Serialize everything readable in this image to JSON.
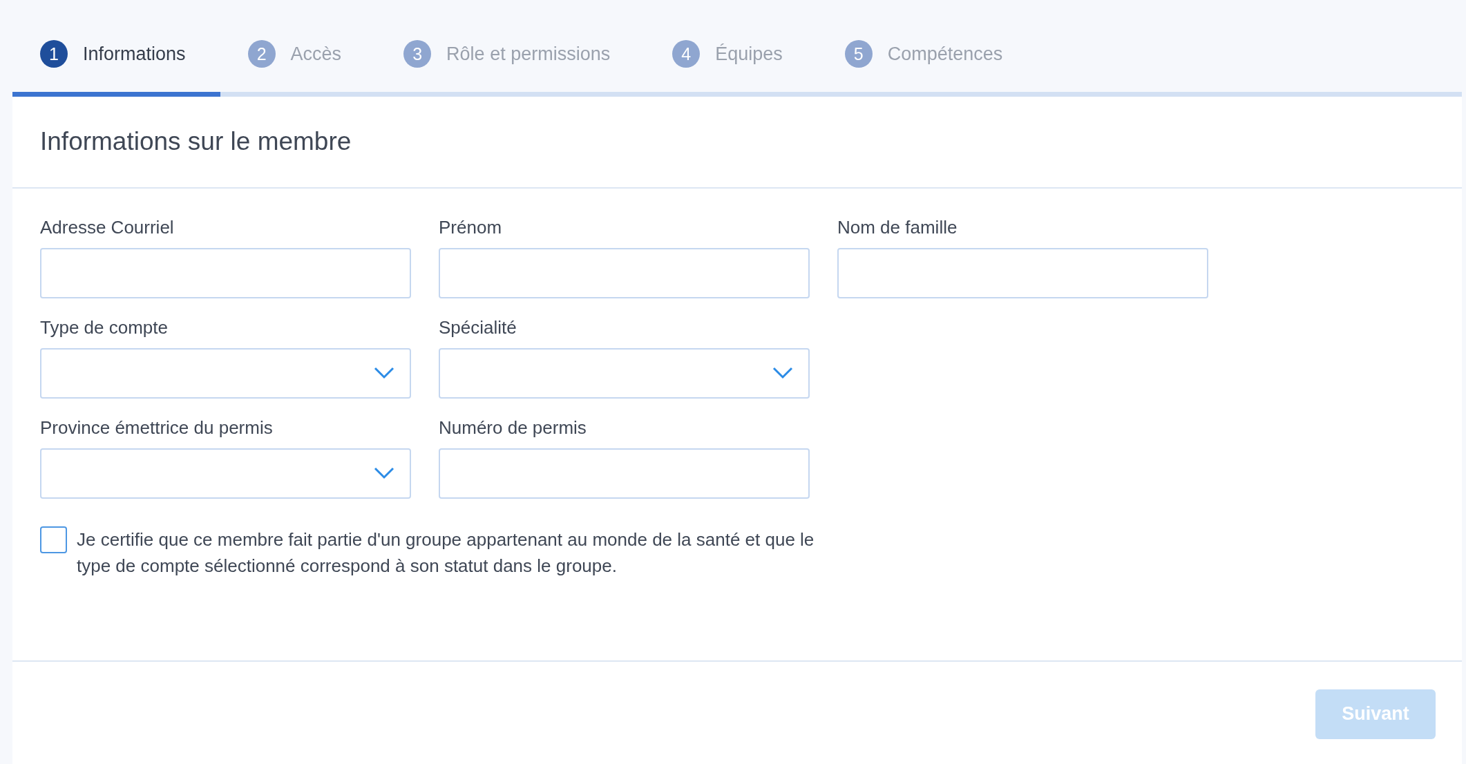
{
  "steps": [
    {
      "number": "1",
      "label": "Informations",
      "selected": true
    },
    {
      "number": "2",
      "label": "Accès",
      "selected": false
    },
    {
      "number": "3",
      "label": "Rôle et permissions",
      "selected": false
    },
    {
      "number": "4",
      "label": "Équipes",
      "selected": false
    },
    {
      "number": "5",
      "label": "Compétences",
      "selected": false
    }
  ],
  "card": {
    "title": "Informations sur le membre",
    "rows": [
      [
        {
          "label": "Adresse Courriel",
          "kind": "text"
        },
        {
          "label": "Prénom",
          "kind": "text"
        },
        {
          "label": "Nom de famille",
          "kind": "text"
        }
      ],
      [
        {
          "label": "Type de compte",
          "kind": "select"
        },
        {
          "label": "Spécialité",
          "kind": "select"
        }
      ],
      [
        {
          "label": "Province émettrice du permis",
          "kind": "select"
        },
        {
          "label": "Numéro de permis",
          "kind": "text"
        }
      ]
    ],
    "certification": {
      "checked": false,
      "text": "Je certifie que ce membre fait partie d'un groupe appartenant au monde de la santé et que le type de compte sélectionné correspond à son statut dans le groupe."
    },
    "next_button": {
      "label": "Suivant",
      "disabled": true
    }
  }
}
